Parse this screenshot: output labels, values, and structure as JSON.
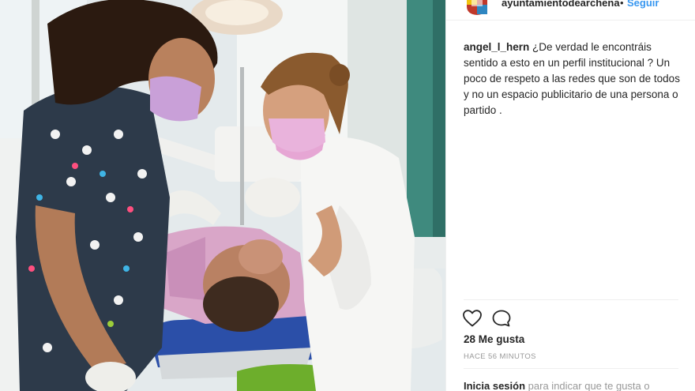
{
  "post": {
    "author": "ayuntamientodearchena",
    "separator": "•",
    "follow_label": "Seguir"
  },
  "comment": {
    "user": "angel_l_hern",
    "text": "¿De verdad le encontráis sentido a esto en un perfil institucional ? Un poco de respeto a las redes que son de todos y no un espacio publicitario de una persona o partido ."
  },
  "actions": {
    "like_icon": "heart-icon",
    "comment_icon": "speech-bubble-icon"
  },
  "likes": {
    "text": "28 Me gusta"
  },
  "time": {
    "text": "HACE 56 MINUTOS"
  },
  "login": {
    "link": "Inicia sesión",
    "rest": "para indicar que te gusta o"
  },
  "colors": {
    "follow": "#3897f0",
    "text": "#262626",
    "muted": "#999999"
  }
}
